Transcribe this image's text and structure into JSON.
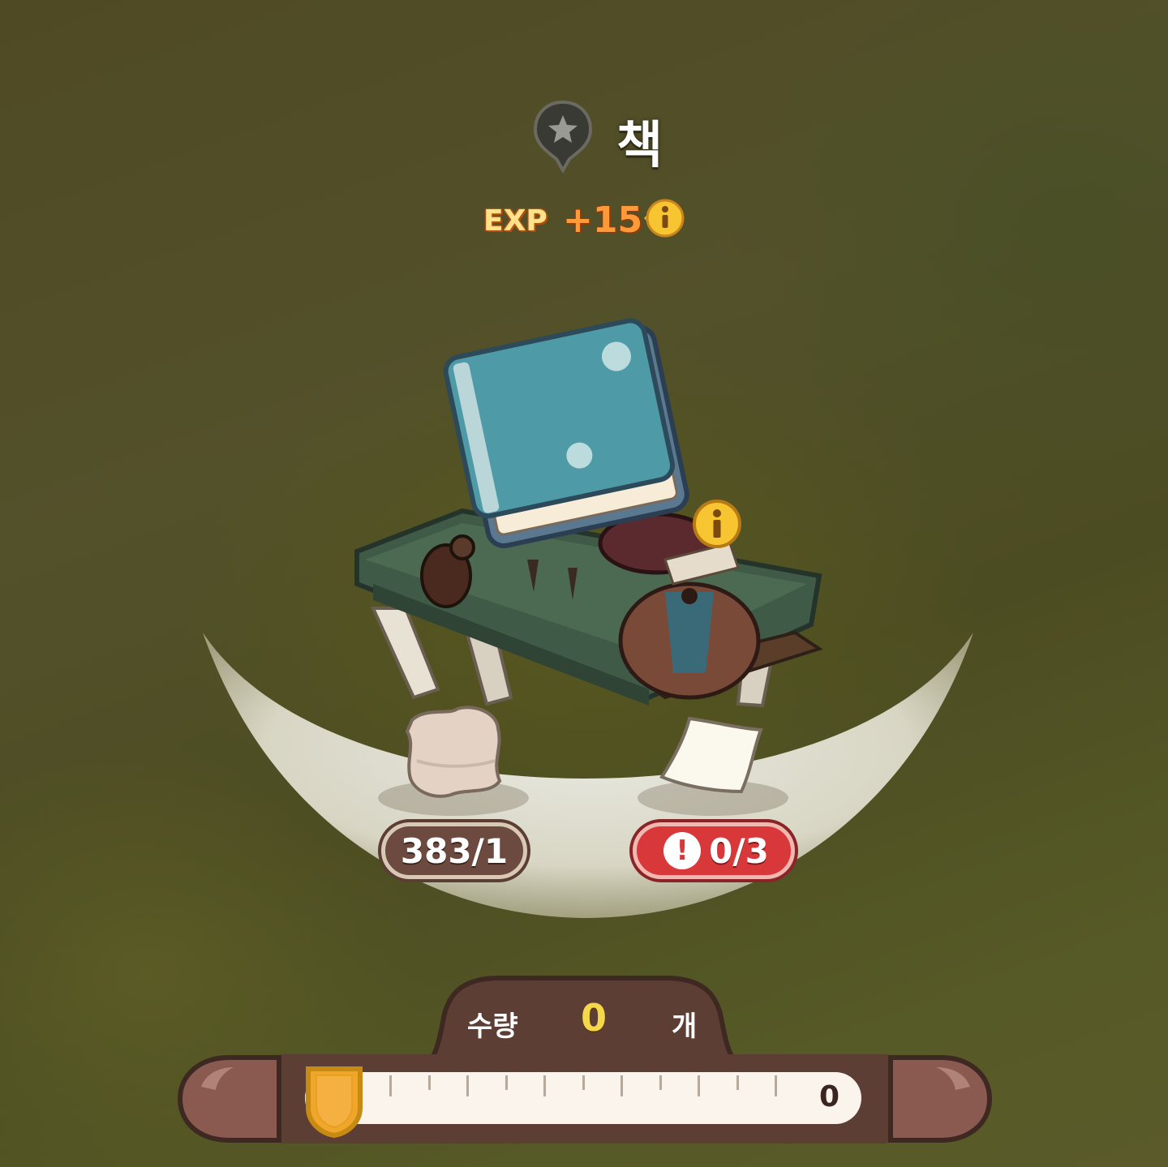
{
  "item": {
    "name": "책",
    "icon": "star-pin-icon"
  },
  "reward": {
    "exp_label": "EXP",
    "exp_value": "+15",
    "info_icon": "info-icon"
  },
  "materials": [
    {
      "icon": "cotton-icon",
      "count": "383/1",
      "sufficient": true
    },
    {
      "icon": "paper-icon",
      "count": "0/3",
      "sufficient": false,
      "warning_symbol": "!"
    }
  ],
  "quantity": {
    "label": "수량",
    "value": "0",
    "unit": "개",
    "max": "0"
  },
  "colors": {
    "warning": "#d8383a",
    "panel": "#5c3e35",
    "accent": "#f5d84a",
    "exp": "#ff9a3a"
  }
}
